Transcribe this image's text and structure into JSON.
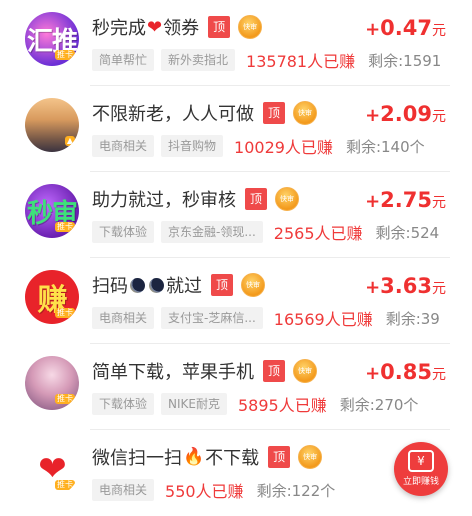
{
  "tasks": [
    {
      "title_pre": "秒完成",
      "emoji": "❤",
      "title_post": "领券",
      "emoji_type": "heart",
      "avatar_text": "汇推",
      "avatar_badge": "推卡",
      "avatar_bg": "#6b2fd6",
      "tag_top": "顶",
      "tag_fast": "快审",
      "reward_plus": "+",
      "reward_amount": "0.47",
      "reward_unit": "元",
      "chips": [
        "简单帮忙",
        "新外卖指北"
      ],
      "earned": "135781人已赚",
      "remaining": "剩余:1591"
    },
    {
      "title_pre": "不限新老，人人可做",
      "emoji": "",
      "title_post": "",
      "emoji_type": "none",
      "avatar_text": "",
      "avatar_badge": "",
      "avatar_bg": "#b9864a",
      "tag_top": "顶",
      "tag_fast": "快审",
      "reward_plus": "+",
      "reward_amount": "2.09",
      "reward_unit": "元",
      "chips": [
        "电商相关",
        "抖音购物"
      ],
      "earned": "10029人已赚",
      "remaining": "剩余:140个"
    },
    {
      "title_pre": "助力就过，秒审核",
      "emoji": "",
      "title_post": "",
      "emoji_type": "none",
      "avatar_text": "秒审",
      "avatar_badge": "推卡",
      "avatar_bg": "#7b2bbf",
      "tag_top": "顶",
      "tag_fast": "快审",
      "reward_plus": "+",
      "reward_amount": "2.75",
      "reward_unit": "元",
      "chips": [
        "下载体验",
        "京东金融-领现..."
      ],
      "earned": "2565人已赚",
      "remaining": "剩余:524"
    },
    {
      "title_pre": "扫码",
      "emoji": "moons",
      "title_post": "就过",
      "emoji_type": "moons",
      "avatar_text": "赚",
      "avatar_badge": "推卡",
      "avatar_bg": "#e8232a",
      "tag_top": "顶",
      "tag_fast": "快审",
      "reward_plus": "+",
      "reward_amount": "3.63",
      "reward_unit": "元",
      "chips": [
        "电商相关",
        "支付宝-芝麻信..."
      ],
      "earned": "16569人已赚",
      "remaining": "剩余:39"
    },
    {
      "title_pre": "简单下载，苹果手机",
      "emoji": "",
      "title_post": "",
      "emoji_type": "none",
      "avatar_text": "",
      "avatar_badge": "推卡",
      "avatar_bg": "#d59ab7",
      "tag_top": "顶",
      "tag_fast": "快审",
      "reward_plus": "+",
      "reward_amount": "0.85",
      "reward_unit": "元",
      "chips": [
        "下载体验",
        "NIKE耐克"
      ],
      "earned": "5895人已赚",
      "remaining": "剩余:270个"
    },
    {
      "title_pre": "微信扫一扫",
      "emoji": "🔥",
      "title_post": "不下载",
      "emoji_type": "fire",
      "avatar_text": "❤",
      "avatar_badge": "推卡",
      "avatar_bg": "#ffffff",
      "tag_top": "顶",
      "tag_fast": "快审",
      "reward_plus": "+",
      "reward_amount": "",
      "reward_unit": "",
      "chips": [
        "电商相关",
        ""
      ],
      "earned": "550人已赚",
      "remaining": "剩余:122个"
    }
  ],
  "fab": {
    "icon_text": "¥",
    "label": "立即赚钱"
  },
  "colors": {
    "accent": "#ef3030",
    "chip_bg": "#f2f2f2",
    "top_tag": "#ef4a4a",
    "fast_tag": "#f39a1c"
  }
}
